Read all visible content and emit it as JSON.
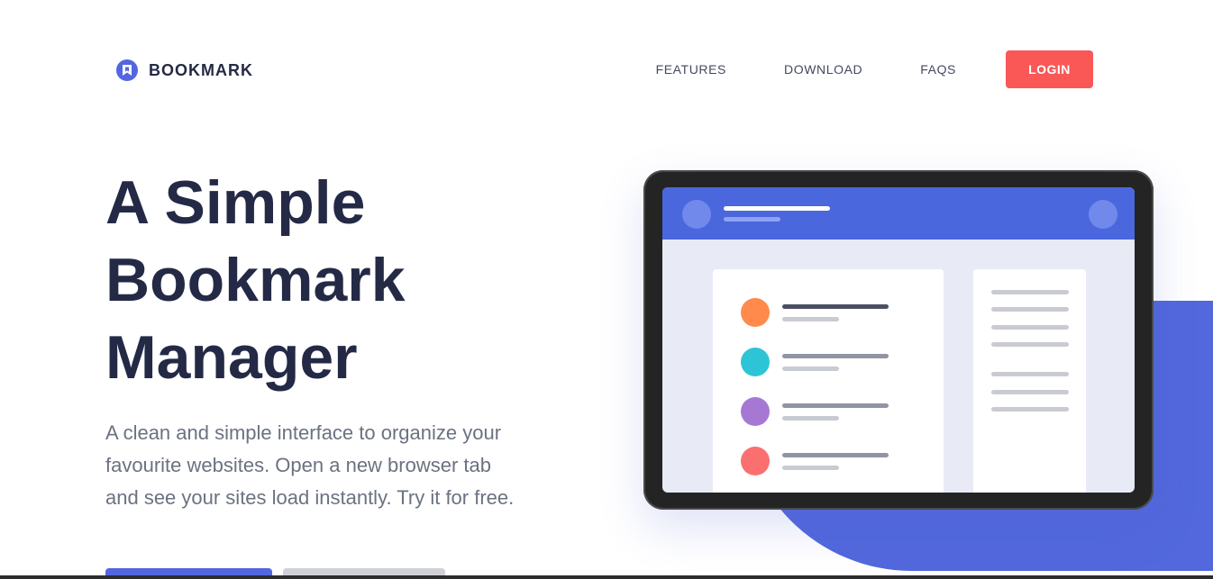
{
  "brand": {
    "name": "BOOKMARK",
    "accent_color": "#5267df",
    "icon": "bookmark-icon"
  },
  "nav": {
    "links": [
      "FEATURES",
      "DOWNLOAD",
      "FAQS"
    ],
    "login_label": "LOGIN",
    "login_color": "#fa5757"
  },
  "hero": {
    "title_lines": [
      "A Simple",
      "Bookmark",
      "Manager"
    ],
    "description": "A clean and simple interface to organize your favourite websites. Open a new browser tab and see your sites load instantly. Try it for free."
  },
  "illustration": {
    "list_item_colors": [
      "#ff8a4c",
      "#2dc5d6",
      "#a678d4",
      "#fa6f6f"
    ]
  }
}
